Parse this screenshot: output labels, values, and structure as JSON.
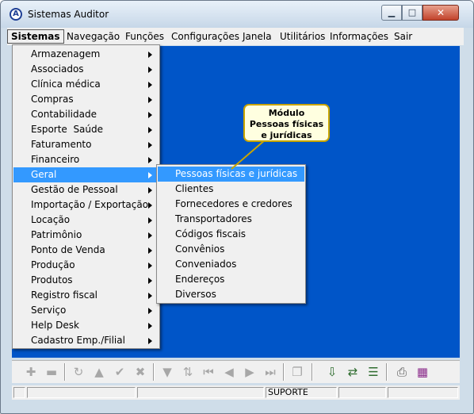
{
  "window": {
    "title": "Sistemas Auditor",
    "app_icon_letter": "A"
  },
  "window_controls": {
    "minimize": "▁",
    "maximize": "□",
    "close": "✕"
  },
  "menubar": {
    "items": [
      "Sistemas",
      "Navegação",
      "Funções",
      "Configurações",
      "Janela",
      "Utilitários",
      "Informações",
      "Sair"
    ],
    "active": "Sistemas"
  },
  "sistemas_menu": {
    "items": [
      {
        "label": "Armazenagem"
      },
      {
        "label": "Associados"
      },
      {
        "label": "Clínica médica"
      },
      {
        "label": "Compras"
      },
      {
        "label": "Contabilidade"
      },
      {
        "label": "Esporte  Saúde"
      },
      {
        "label": "Faturamento"
      },
      {
        "label": "Financeiro"
      },
      {
        "label": "Geral"
      },
      {
        "label": "Gestão de Pessoal"
      },
      {
        "label": "Importação / Exportação"
      },
      {
        "label": "Locação"
      },
      {
        "label": "Patrimônio"
      },
      {
        "label": "Ponto de Venda"
      },
      {
        "label": "Produção"
      },
      {
        "label": "Produtos"
      },
      {
        "label": "Registro fiscal"
      },
      {
        "label": "Serviço"
      },
      {
        "label": "Help Desk"
      },
      {
        "label": "Cadastro Emp./Filial"
      }
    ],
    "highlighted": "Geral"
  },
  "geral_submenu": {
    "items": [
      {
        "label": "Pessoas físicas e jurídicas"
      },
      {
        "label": "Clientes"
      },
      {
        "label": "Fornecedores e credores"
      },
      {
        "label": "Transportadores"
      },
      {
        "label": "Códigos fiscais"
      },
      {
        "label": "Convênios"
      },
      {
        "label": "Conveniados"
      },
      {
        "label": "Endereços"
      },
      {
        "label": "Diversos"
      }
    ],
    "highlighted": "Pessoas físicas e jurídicas"
  },
  "callout": {
    "line1": "Módulo",
    "line2": "Pessoas físicas",
    "line3": "e jurídicas"
  },
  "toolbar": {
    "icons": [
      {
        "name": "add-icon",
        "glyph": "✚"
      },
      {
        "name": "remove-icon",
        "glyph": "▬"
      },
      {
        "name": "refresh-icon",
        "glyph": "↻"
      },
      {
        "name": "up-icon",
        "glyph": "▲"
      },
      {
        "name": "confirm-icon",
        "glyph": "✔"
      },
      {
        "name": "cancel-icon",
        "glyph": "✖"
      },
      {
        "name": "filter-icon",
        "glyph": "▼"
      },
      {
        "name": "sort-icon",
        "glyph": "⇅"
      },
      {
        "name": "first-icon",
        "glyph": "⏮"
      },
      {
        "name": "previous-icon",
        "glyph": "◀"
      },
      {
        "name": "next-icon",
        "glyph": "▶"
      },
      {
        "name": "last-icon",
        "glyph": "⏭"
      },
      {
        "name": "copy-icon",
        "glyph": "❐"
      },
      {
        "name": "import-icon",
        "glyph": "⇩"
      },
      {
        "name": "transfer-icon",
        "glyph": "⇄"
      },
      {
        "name": "list-icon",
        "glyph": "☰"
      },
      {
        "name": "print-icon",
        "glyph": "⎙"
      },
      {
        "name": "calendar-icon",
        "glyph": "▦"
      }
    ]
  },
  "statusbar": {
    "panels": [
      "",
      "",
      "",
      "SUPORTE",
      "",
      ""
    ]
  }
}
